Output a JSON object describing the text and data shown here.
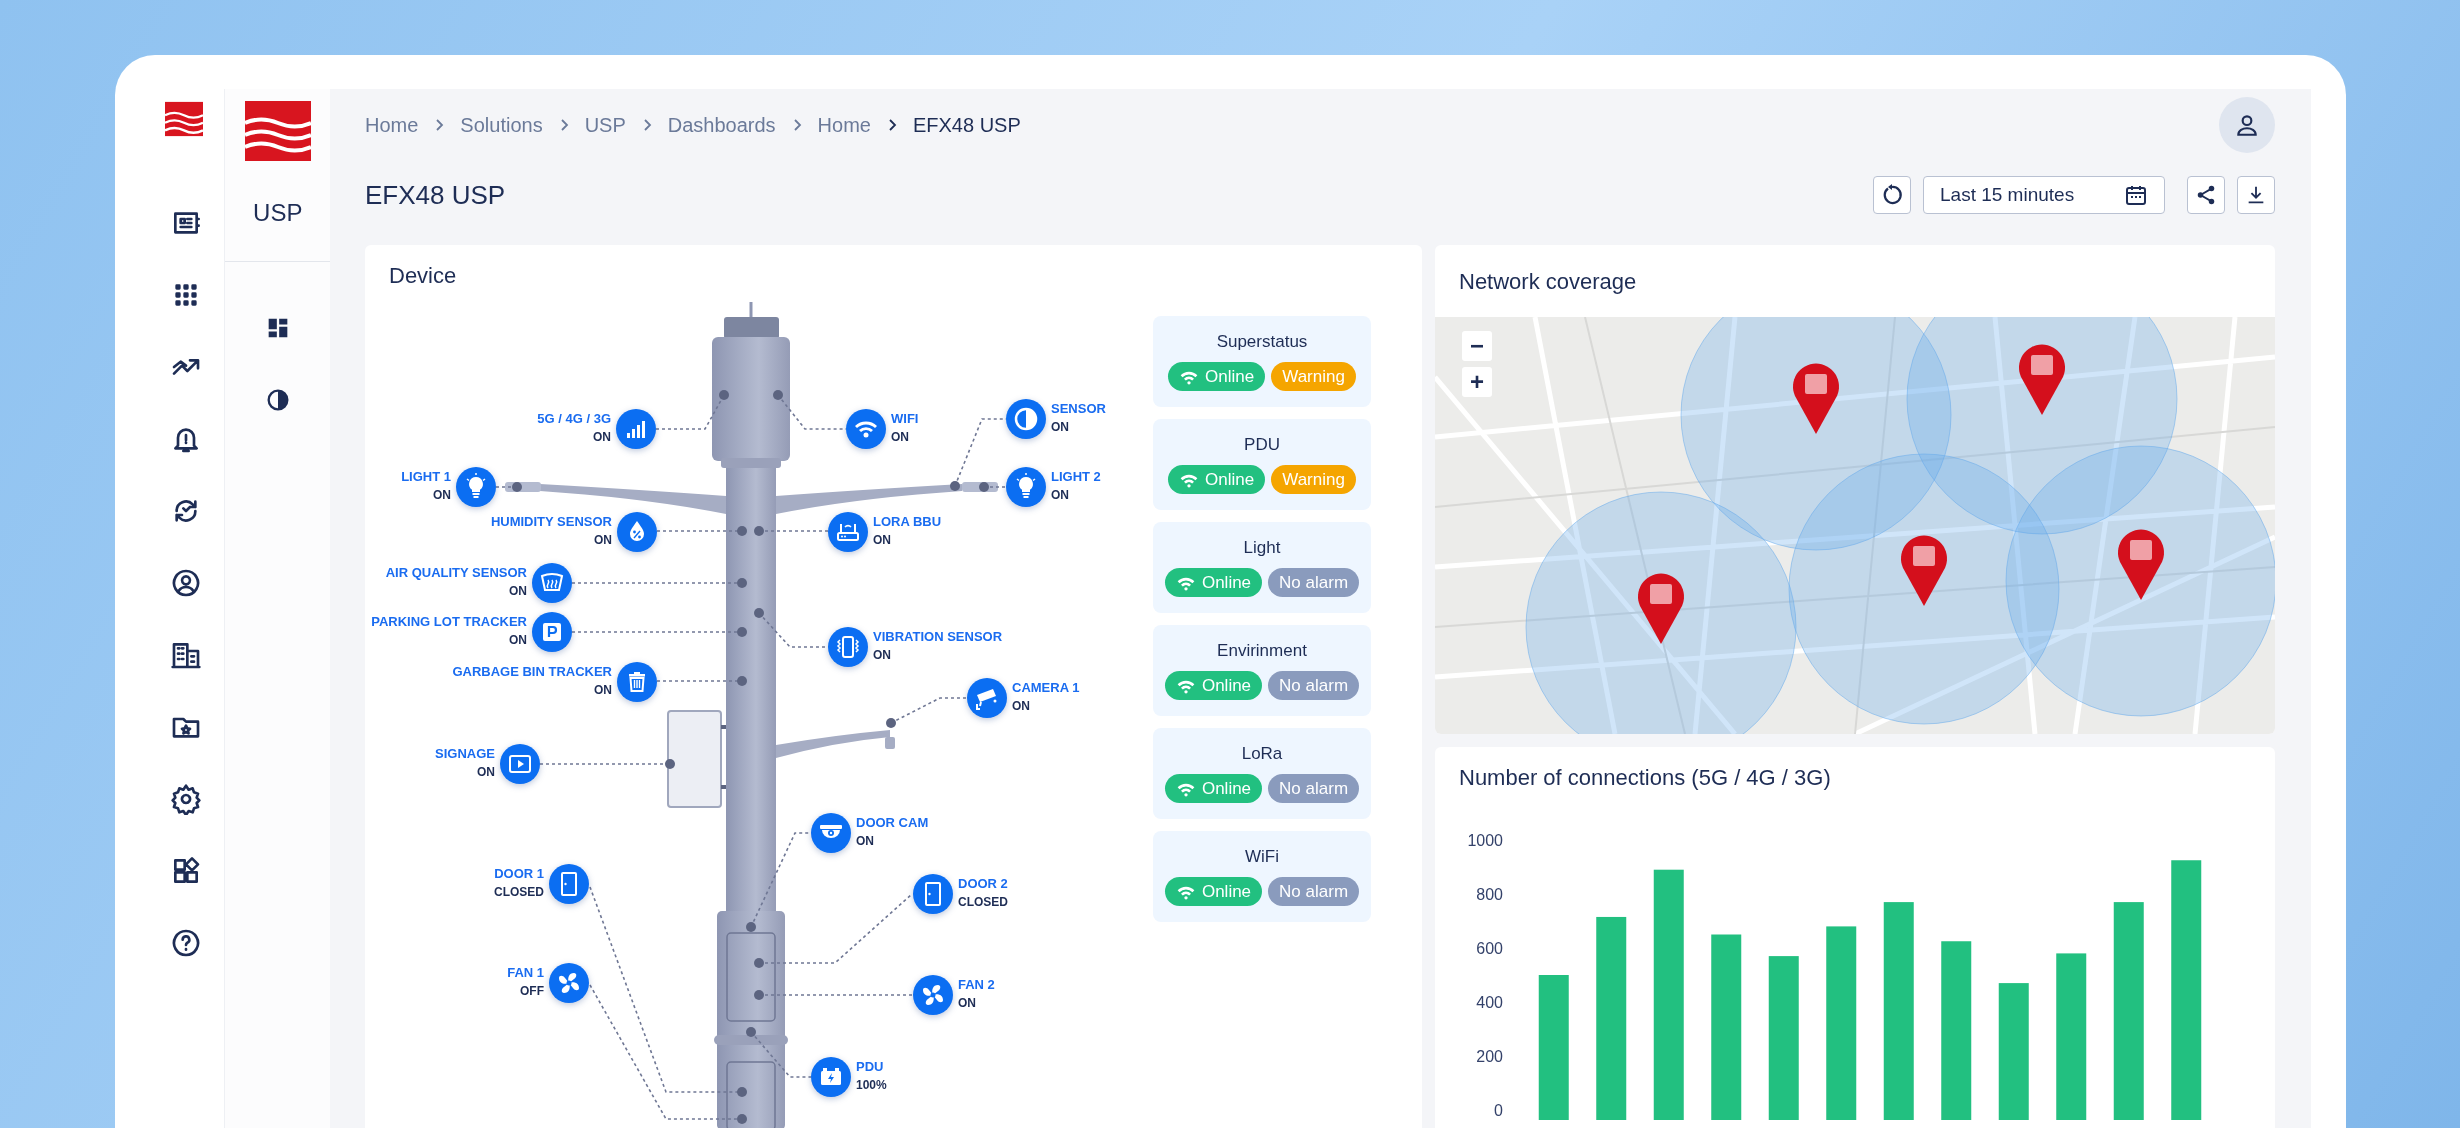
{
  "app": {
    "name": "USP"
  },
  "breadcrumbs": [
    {
      "label": "Home",
      "current": false
    },
    {
      "label": "Solutions",
      "current": false
    },
    {
      "label": "USP",
      "current": false
    },
    {
      "label": "Dashboards",
      "current": false
    },
    {
      "label": "Home",
      "current": false
    },
    {
      "label": "EFX48 USP",
      "current": true
    }
  ],
  "page_title": "EFX48 USP",
  "toolbar": {
    "time_range": "Last 15 minutes"
  },
  "device": {
    "title": "Device",
    "nodes": [
      {
        "kind": "signal",
        "label": "5G / 4G / 3G",
        "status": "ON"
      },
      {
        "kind": "wifi",
        "label": "WIFI",
        "status": "ON"
      },
      {
        "kind": "contrast",
        "label": "SENSOR",
        "status": "ON"
      },
      {
        "kind": "bulb",
        "label": "LIGHT 1",
        "status": "ON"
      },
      {
        "kind": "bulb",
        "label": "LIGHT 2",
        "status": "ON"
      },
      {
        "kind": "humidity",
        "label": "HUMIDITY SENSOR",
        "status": "ON"
      },
      {
        "kind": "router",
        "label": "LORA BBU",
        "status": "ON"
      },
      {
        "kind": "air",
        "label": "AIR QUALITY SENSOR",
        "status": "ON"
      },
      {
        "kind": "parking",
        "label": "PARKING LOT TRACKER",
        "status": "ON"
      },
      {
        "kind": "vibration",
        "label": "VIBRATION SENSOR",
        "status": "ON"
      },
      {
        "kind": "trash",
        "label": "GARBAGE BIN TRACKER",
        "status": "ON"
      },
      {
        "kind": "camera",
        "label": "CAMERA 1",
        "status": "ON"
      },
      {
        "kind": "screen",
        "label": "SIGNAGE",
        "status": "ON"
      },
      {
        "kind": "domecam",
        "label": "DOOR CAM",
        "status": "ON"
      },
      {
        "kind": "door",
        "label": "DOOR 1",
        "status": "CLOSED"
      },
      {
        "kind": "door",
        "label": "DOOR 2",
        "status": "CLOSED"
      },
      {
        "kind": "fan",
        "label": "FAN 1",
        "status": "OFF"
      },
      {
        "kind": "fan",
        "label": "FAN 2",
        "status": "ON"
      },
      {
        "kind": "battery",
        "label": "PDU",
        "status": "100%"
      }
    ],
    "statuses": [
      {
        "name": "Superstatus",
        "online": "Online",
        "alarm": "Warning",
        "warning": true
      },
      {
        "name": "PDU",
        "online": "Online",
        "alarm": "Warning",
        "warning": true
      },
      {
        "name": "Light",
        "online": "Online",
        "alarm": "No alarm",
        "warning": false
      },
      {
        "name": "Envirinment",
        "online": "Online",
        "alarm": "No alarm",
        "warning": false
      },
      {
        "name": "LoRa",
        "online": "Online",
        "alarm": "No alarm",
        "warning": false
      },
      {
        "name": "WiFi",
        "online": "Online",
        "alarm": "No alarm",
        "warning": false
      }
    ]
  },
  "network": {
    "title": "Network coverage",
    "zoom_out": "−",
    "zoom_in": "+"
  },
  "connections": {
    "title": "Number of connections (5G / 4G / 3G)",
    "chart_data": {
      "type": "bar",
      "ylim": [
        0,
        1000
      ],
      "yticks": [
        0,
        200,
        400,
        600,
        800,
        1000
      ],
      "series": [
        {
          "color": "#22c080",
          "values": [
            500,
            715,
            890,
            650,
            570,
            680,
            770,
            625,
            470,
            580,
            770,
            925
          ]
        }
      ]
    }
  }
}
